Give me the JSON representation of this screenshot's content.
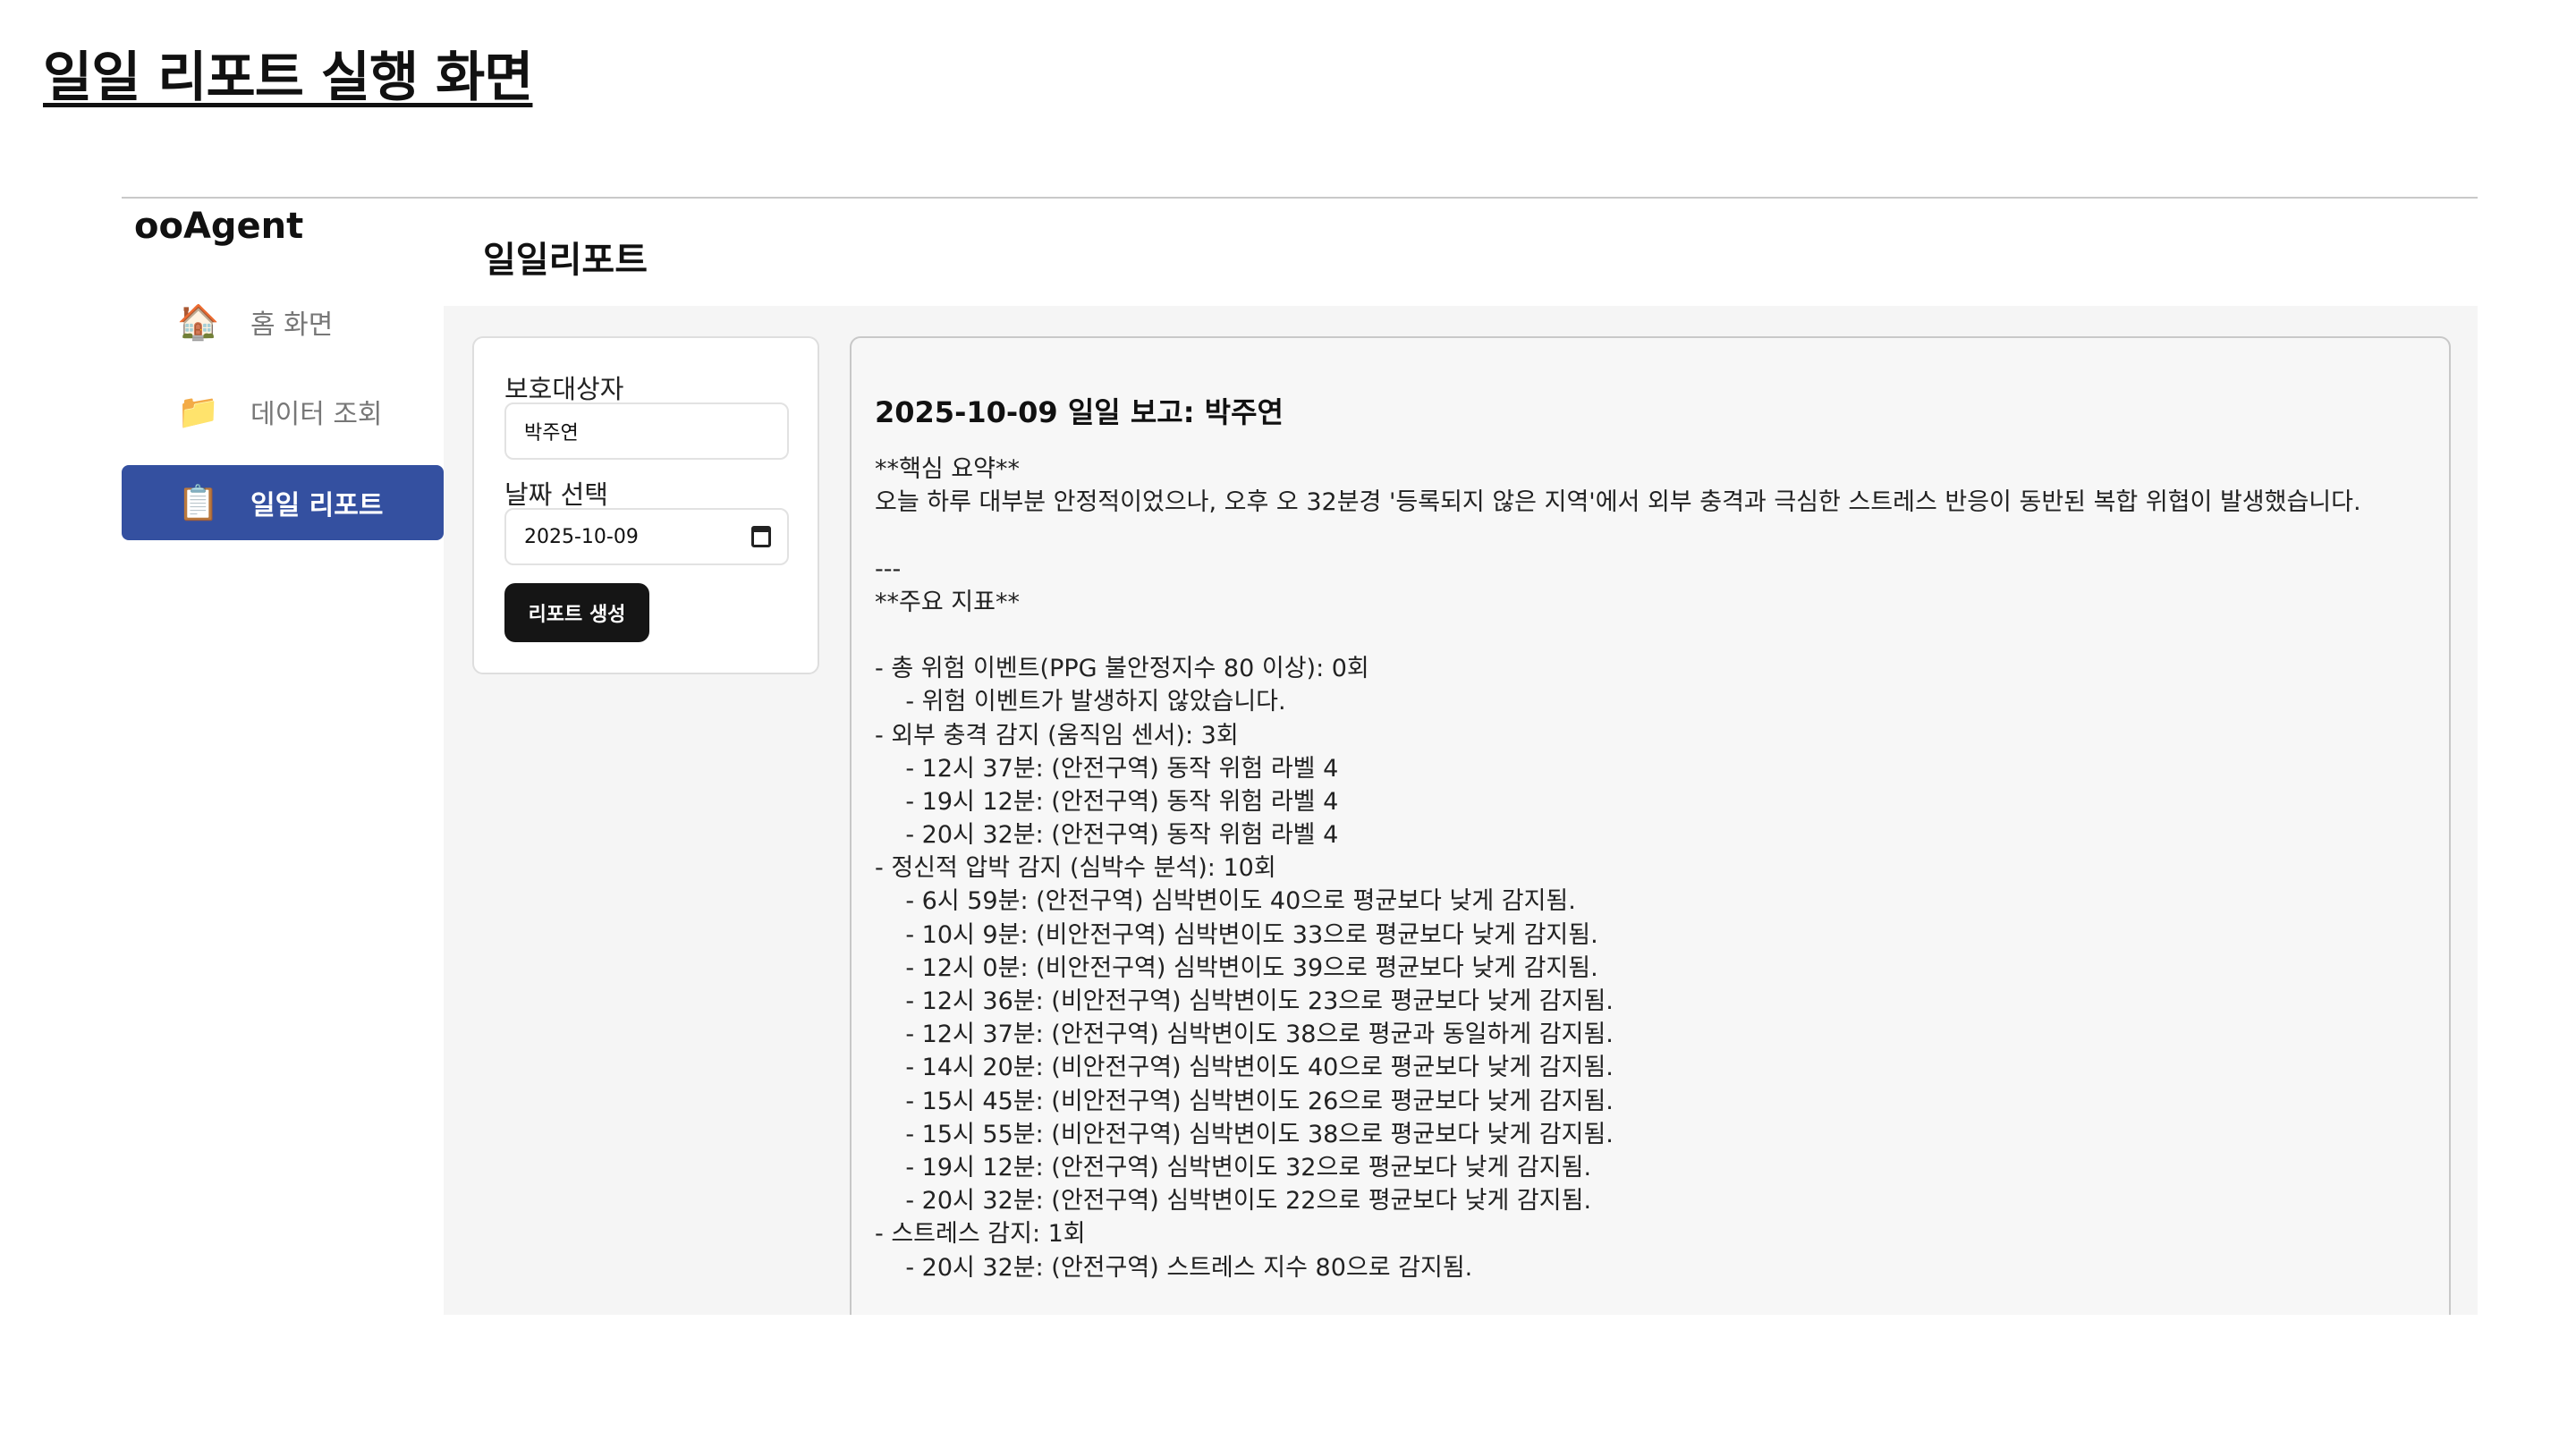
{
  "slide_title": "일일 리포트 실행 화면",
  "brand": "ooAgent",
  "sidebar": {
    "items": [
      {
        "icon": "🏠",
        "label": "홈 화면",
        "active": false
      },
      {
        "icon": "📁",
        "label": "데이터 조회",
        "active": false
      },
      {
        "icon": "📋",
        "label": "일일 리포트",
        "active": true
      }
    ]
  },
  "header": {
    "title": "일일리포트"
  },
  "form": {
    "guardian_label": "보호대상자",
    "guardian_value": "박주연",
    "date_label": "날짜 선택",
    "date_value": "2025-10-09",
    "generate_label": "리포트 생성"
  },
  "report": {
    "heading": "2025-10-09 일일 보고: 박주연",
    "lines": [
      "**핵심 요약**",
      "오늘 하루 대부분 안정적이었으나, 오후 오 32분경 '등록되지 않은 지역'에서 외부 충격과 극심한 스트레스 반응이 동반된 복합 위협이 발생했습니다.",
      "",
      "---",
      "**주요 지표**",
      "",
      "- 총 위험 이벤트(PPG 불안정지수 80 이상): 0회",
      "    - 위험 이벤트가 발생하지 않았습니다.",
      "- 외부 충격 감지 (움직임 센서): 3회",
      "    - 12시 37분: (안전구역) 동작 위험 라벨 4",
      "    - 19시 12분: (안전구역) 동작 위험 라벨 4",
      "    - 20시 32분: (안전구역) 동작 위험 라벨 4",
      "- 정신적 압박 감지 (심박수 분석): 10회",
      "    - 6시 59분: (안전구역) 심박변이도 40으로 평균보다 낮게 감지됨.",
      "    - 10시 9분: (비안전구역) 심박변이도 33으로 평균보다 낮게 감지됨.",
      "    - 12시 0분: (비안전구역) 심박변이도 39으로 평균보다 낮게 감지됨.",
      "    - 12시 36분: (비안전구역) 심박변이도 23으로 평균보다 낮게 감지됨.",
      "    - 12시 37분: (안전구역) 심박변이도 38으로 평균과 동일하게 감지됨.",
      "    - 14시 20분: (비안전구역) 심박변이도 40으로 평균보다 낮게 감지됨.",
      "    - 15시 45분: (비안전구역) 심박변이도 26으로 평균보다 낮게 감지됨.",
      "    - 15시 55분: (비안전구역) 심박변이도 38으로 평균보다 낮게 감지됨.",
      "    - 19시 12분: (안전구역) 심박변이도 32으로 평균보다 낮게 감지됨.",
      "    - 20시 32분: (안전구역) 심박변이도 22으로 평균보다 낮게 감지됨.",
      "- 스트레스 감지: 1회",
      "    - 20시 32분: (안전구역) 스트레스 지수 80으로 감지됨."
    ]
  }
}
